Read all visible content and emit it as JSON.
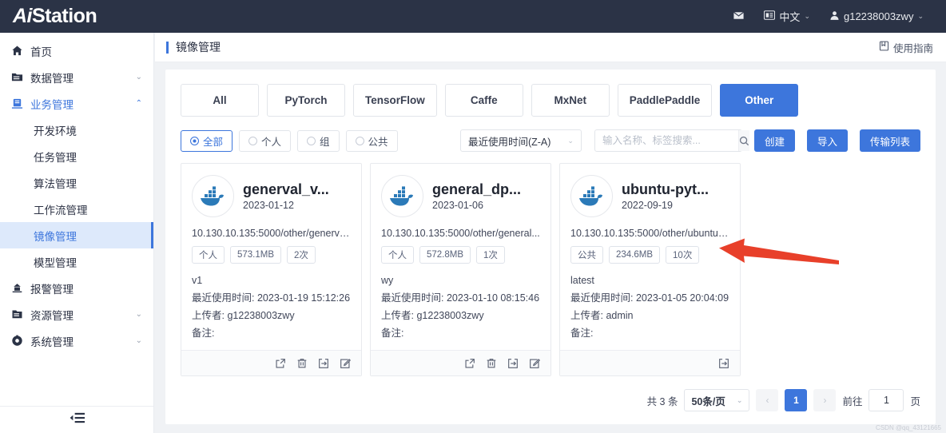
{
  "topbar": {
    "logo_ai": "Ai",
    "logo_station": "Station",
    "mail_icon": "mail-icon",
    "lang_icon": "language-icon",
    "lang_label": "中文",
    "user_icon": "user-avatar-icon",
    "user_label": "g12238003zwy"
  },
  "sidebar": {
    "items": [
      {
        "label": "首页",
        "icon": "home-icon",
        "arrow": "",
        "level": "top",
        "state": ""
      },
      {
        "label": "数据管理",
        "icon": "database-folder-icon",
        "arrow": "⌄",
        "level": "top",
        "state": ""
      },
      {
        "label": "业务管理",
        "icon": "business-icon",
        "arrow": "⌃",
        "level": "top",
        "state": "active"
      },
      {
        "label": "开发环境",
        "icon": "",
        "arrow": "",
        "level": "sub",
        "state": ""
      },
      {
        "label": "任务管理",
        "icon": "",
        "arrow": "",
        "level": "sub",
        "state": ""
      },
      {
        "label": "算法管理",
        "icon": "",
        "arrow": "",
        "level": "sub",
        "state": ""
      },
      {
        "label": "工作流管理",
        "icon": "",
        "arrow": "",
        "level": "sub",
        "state": ""
      },
      {
        "label": "镜像管理",
        "icon": "",
        "arrow": "",
        "level": "sub",
        "state": "selected"
      },
      {
        "label": "模型管理",
        "icon": "",
        "arrow": "",
        "level": "sub",
        "state": ""
      },
      {
        "label": "报警管理",
        "icon": "alarm-icon",
        "arrow": "",
        "level": "top",
        "state": ""
      },
      {
        "label": "资源管理",
        "icon": "resource-icon",
        "arrow": "⌄",
        "level": "top",
        "state": ""
      },
      {
        "label": "系统管理",
        "icon": "system-gear-icon",
        "arrow": "⌄",
        "level": "top",
        "state": ""
      }
    ],
    "collapse_icon": "menu-fold-icon"
  },
  "page": {
    "title": "镜像管理",
    "guide_label": "使用指南",
    "guide_icon": "guide-book-icon"
  },
  "tabs": [
    {
      "label": "All",
      "active": false
    },
    {
      "label": "PyTorch",
      "active": false
    },
    {
      "label": "TensorFlow",
      "active": false
    },
    {
      "label": "Caffe",
      "active": false
    },
    {
      "label": "MxNet",
      "active": false
    },
    {
      "label": "PaddlePaddle",
      "active": false
    },
    {
      "label": "Other",
      "active": true
    }
  ],
  "toolbar": {
    "radios": [
      {
        "label": "全部",
        "checked": true
      },
      {
        "label": "个人",
        "checked": false
      },
      {
        "label": "组",
        "checked": false
      },
      {
        "label": "公共",
        "checked": false
      }
    ],
    "sort_value": "最近使用时间(Z-A)",
    "sort_caret_icon": "chevron-down-icon",
    "search_placeholder": "输入名称、标签搜索...",
    "search_value": "",
    "search_icon": "search-icon",
    "buttons": [
      {
        "label": "创建",
        "name": "create-button"
      },
      {
        "label": "导入",
        "name": "import-button"
      },
      {
        "label": "传输列表",
        "name": "transfer-list-button"
      }
    ]
  },
  "card_labels": {
    "last_used": "最近使用时间:",
    "uploader": "上传者:",
    "remark": "备注:"
  },
  "cards": [
    {
      "name": "generval_v...",
      "date": "2023-01-12",
      "url": "10.130.10.135:5000/other/generva...",
      "tags": [
        "个人",
        "573.1MB",
        "2次"
      ],
      "version": "v1",
      "last_used": "2023-01-19 15:12:26",
      "uploader": "g12238003zwy",
      "remark": "",
      "actions": [
        "share-icon",
        "delete-icon",
        "export-icon",
        "edit-icon"
      ]
    },
    {
      "name": "general_dp...",
      "date": "2023-01-06",
      "url": "10.130.10.135:5000/other/general...",
      "tags": [
        "个人",
        "572.8MB",
        "1次"
      ],
      "version": "wy",
      "last_used": "2023-01-10 08:15:46",
      "uploader": "g12238003zwy",
      "remark": "",
      "actions": [
        "share-icon",
        "delete-icon",
        "export-icon",
        "edit-icon"
      ]
    },
    {
      "name": "ubuntu-pyt...",
      "date": "2022-09-19",
      "url": "10.130.10.135:5000/other/ubuntu-...",
      "tags": [
        "公共",
        "234.6MB",
        "10次"
      ],
      "version": "latest",
      "last_used": "2023-01-05 20:04:09",
      "uploader": "admin",
      "remark": "",
      "actions": [
        "export-icon"
      ]
    }
  ],
  "pagination": {
    "total_text": "共 3 条",
    "page_size": "50条/页",
    "page_size_caret_icon": "chevron-down-icon",
    "prev_icon": "chevron-left-icon",
    "next_icon": "chevron-right-icon",
    "current_page": "1",
    "goto_label": "前往",
    "goto_value": "1",
    "goto_suffix": "页"
  },
  "annotation": {
    "arrow_color": "#e8402a",
    "arrow_name": "red-pointer-arrow"
  },
  "watermark": "CSDN @qq_43121665"
}
